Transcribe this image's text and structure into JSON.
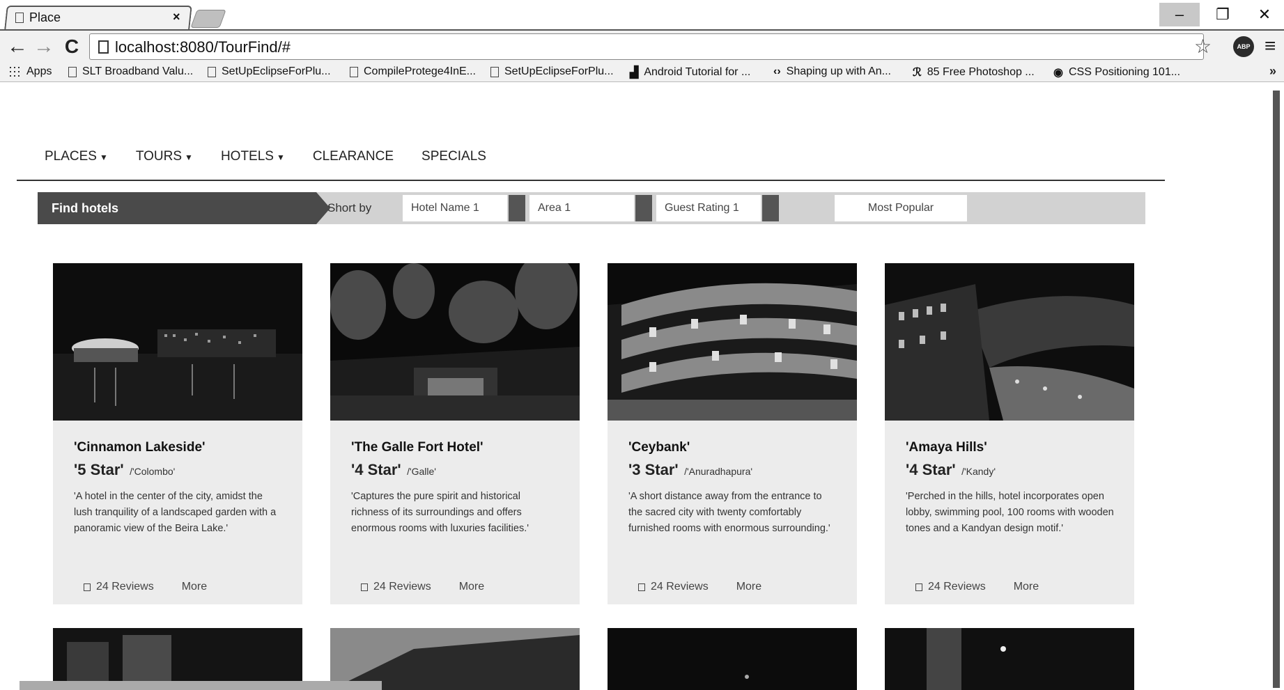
{
  "browser": {
    "tab_title": "Place",
    "tab_close": "×",
    "url": "localhost:8080/TourFind/#",
    "window": {
      "minimize": "–",
      "restore": "❐",
      "close": "✕"
    },
    "nav": {
      "back": "←",
      "forward": "→",
      "reload": "C"
    },
    "extension": "ABP",
    "bookmarks": [
      {
        "label": "Apps",
        "icon": "apps-grid-icon"
      },
      {
        "label": "SLT Broadband Valu...",
        "icon": "page-icon"
      },
      {
        "label": "SetUpEclipseForPlu...",
        "icon": "page-icon"
      },
      {
        "label": "CompileProtege4InE...",
        "icon": "page-icon"
      },
      {
        "label": "SetUpEclipseForPlu...",
        "icon": "page-icon"
      },
      {
        "label": "Android Tutorial for ...",
        "icon": "android-tutorial-icon"
      },
      {
        "label": "Shaping up with An...",
        "icon": "code-icon"
      },
      {
        "label": "85 Free Photoshop ...",
        "icon": "photoshop-icon"
      },
      {
        "label": "CSS Positioning 101...",
        "icon": "css-icon"
      }
    ],
    "bookmarks_more": "»"
  },
  "site": {
    "menu": [
      {
        "label": "PLACES",
        "dropdown": true
      },
      {
        "label": "TOURS",
        "dropdown": true
      },
      {
        "label": "HOTELS",
        "dropdown": true
      },
      {
        "label": "CLEARANCE",
        "dropdown": false
      },
      {
        "label": "SPECIALS",
        "dropdown": false
      }
    ],
    "filter": {
      "title": "Find hotels",
      "sort_label": "Short by",
      "selects": [
        "Hotel Name 1",
        "Area 1",
        "Guest Rating 1"
      ],
      "most_popular": "Most Popular"
    },
    "hotels": [
      {
        "name": "'Cinnamon Lakeside'",
        "stars": "'5 Star'",
        "city": "/'Colombo'",
        "description": "'A hotel in the center of the city, amidst the lush tranquility of a landscaped garden with a panoramic view of the Beira Lake.'",
        "reviews": "24 Reviews",
        "more": "More"
      },
      {
        "name": "'The Galle Fort Hotel'",
        "stars": "'4 Star'",
        "city": "/'Galle'",
        "description": "'Captures the pure spirit and historical richness of its surroundings and offers enormous rooms with luxuries facilities.'",
        "reviews": "24 Reviews",
        "more": "More"
      },
      {
        "name": "'Ceybank'",
        "stars": "'3 Star'",
        "city": "/'Anuradhapura'",
        "description": "'A short distance away from the entrance to the sacred city with twenty comfortably furnished rooms with enormous surrounding.'",
        "reviews": "24 Reviews",
        "more": "More"
      },
      {
        "name": "'Amaya Hills'",
        "stars": "'4 Star'",
        "city": "/'Kandy'",
        "description": "'Perched in the hills, hotel incorporates open lobby, swimming pool, 100 rooms with wooden tones and a Kandyan design motif.'",
        "reviews": "24 Reviews",
        "more": "More"
      }
    ]
  }
}
